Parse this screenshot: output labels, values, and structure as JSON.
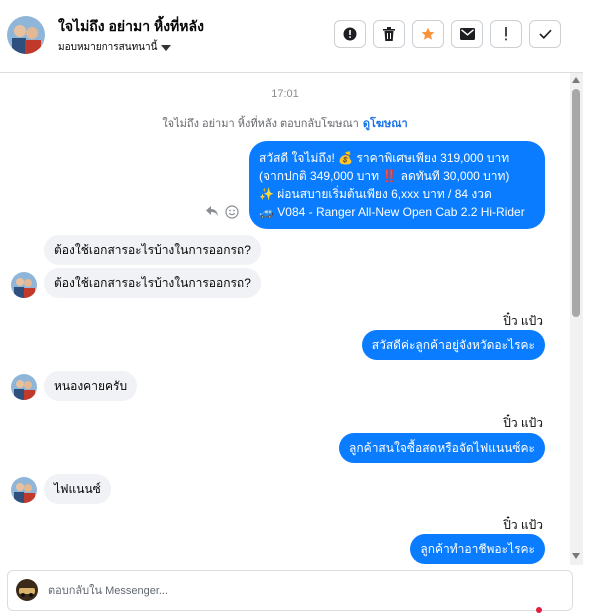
{
  "header": {
    "contact_name": "ใจไม่ถึง อย่ามา หิ้งที่หลัง",
    "assign_label": "มอบหมายการสนทนานี้",
    "actions": [
      {
        "icon": "alert-circle-icon"
      },
      {
        "icon": "trash-icon"
      },
      {
        "icon": "star-icon"
      },
      {
        "icon": "envelope-icon"
      },
      {
        "icon": "exclamation-icon"
      },
      {
        "icon": "check-icon"
      }
    ]
  },
  "chat": {
    "timestamp": "17:01",
    "ad_reply_text": "ใจไม่ถึง อย่ามา หิ้งที่หลัง ตอบกลับโฆษณา",
    "ad_link": "ดูโฆษณา",
    "promo_message": {
      "line1": "สวัสดี ใจไม่ถึง! 💰 ราคาพิเศษเพียง 319,000 บาท",
      "line2": "(จากปกติ 349,000 บาท ‼️ ลดทันที 30,000 บาท)",
      "line3": "✨ ผ่อนสบายเริ่มต้นเพียง 6,xxx บาท / 84 งวด",
      "line4": "🚙 V084 - Ranger All-New Open Cab 2.2 Hi-Rider"
    },
    "messages": [
      {
        "dir": "in",
        "text": "ต้องใช้เอกสารอะไรบ้างในการออกรถ?"
      },
      {
        "dir": "in",
        "text": "ต้องใช้เอกสารอะไรบ้างในการออกรถ?"
      },
      {
        "dir": "out",
        "sender": "ปิ๋ว แป้ว",
        "text": "สวัสดีค่ะลูกค้าอยู่จังหวัดอะไรคะ"
      },
      {
        "dir": "in",
        "text": "หนองคายครับ"
      },
      {
        "dir": "out",
        "sender": "ปิ๋ว แป้ว",
        "text": "ลูกค้าสนใจซื้อสดหรือจัดไฟแนนซ์คะ"
      },
      {
        "dir": "in",
        "text": "ไฟแนนซ์"
      },
      {
        "dir": "out",
        "sender": "ปิ๋ว แป้ว",
        "text": "ลูกค้าทำอาชีพอะไรคะ"
      }
    ]
  },
  "composer": {
    "placeholder": "ตอบกลับใน Messenger..."
  },
  "colors": {
    "outgoing_bubble": "#0a7cff",
    "incoming_bubble": "#f0f2f5",
    "link": "#1a73e8",
    "star": "#f7923b"
  }
}
